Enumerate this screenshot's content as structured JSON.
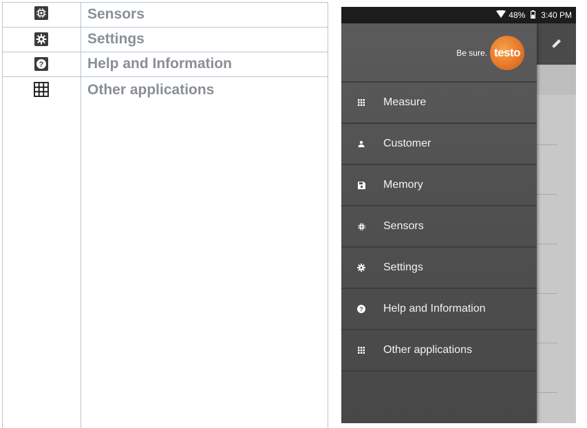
{
  "doc_table": {
    "rows": [
      {
        "icon": "sensors-chip-icon",
        "label": "Sensors"
      },
      {
        "icon": "gear-icon",
        "label": "Settings"
      },
      {
        "icon": "help-icon",
        "label": "Help and Information"
      },
      {
        "icon": "grid-icon",
        "label": "Other applications"
      }
    ]
  },
  "phone": {
    "status_bar": {
      "battery": "48%",
      "time": "3:40 PM",
      "icons": [
        "wifi-icon",
        "battery-icon"
      ]
    },
    "drawer": {
      "slogan": "Be sure.",
      "logo_text": "testo",
      "items": [
        {
          "icon": "grid-icon",
          "label": "Measure"
        },
        {
          "icon": "person-icon",
          "label": "Customer"
        },
        {
          "icon": "save-icon",
          "label": "Memory"
        },
        {
          "icon": "sensors-chip-icon",
          "label": "Sensors"
        },
        {
          "icon": "gear-icon",
          "label": "Settings"
        },
        {
          "icon": "help-icon",
          "label": "Help and Information"
        },
        {
          "icon": "grid-icon",
          "label": "Other applications"
        }
      ]
    },
    "app_bar_icon": "edit-icon",
    "colors": {
      "drawer": "#505050",
      "brand": "#e8792a",
      "status_bar": "#1d1d1d"
    }
  }
}
